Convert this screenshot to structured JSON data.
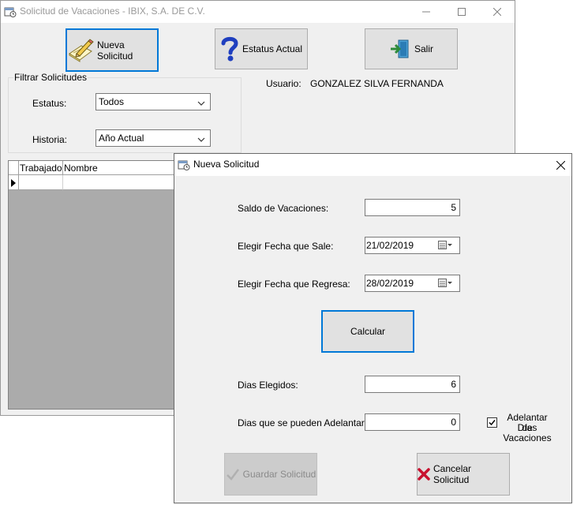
{
  "main_window": {
    "title": "Solicitud de Vacaciones - IBIX, S.A. DE C.V.",
    "toolbar": {
      "new_request_label": "Nueva Solicitud",
      "status_label": "Estatus Actual",
      "exit_label": "Salir"
    },
    "filter": {
      "group_title": "Filtrar Solicitudes",
      "status_label": "Estatus:",
      "status_value": "Todos",
      "history_label": "Historia:",
      "history_value": "Año Actual"
    },
    "user": {
      "label": "Usuario:",
      "name": "GONZALEZ SILVA FERNANDA"
    },
    "grid": {
      "columns": [
        "Trabajador",
        "Nombre"
      ]
    }
  },
  "dialog": {
    "title": "Nueva Solicitud",
    "balance_label": "Saldo de Vacaciones:",
    "balance_value": "5",
    "departure_label": "Elegir Fecha que Sale:",
    "departure_value": "21/02/2019",
    "return_label": "Elegir Fecha que Regresa:",
    "return_value": "28/02/2019",
    "calculate_label": "Calcular",
    "chosen_days_label": "Dias Elegidos:",
    "chosen_days_value": "6",
    "advance_days_label": "Dias que se pueden Adelantar:",
    "advance_days_value": "0",
    "advance_checkbox_line1": "Adelantar Días",
    "advance_checkbox_line2": "de Vacaciones",
    "advance_checkbox_checked": true,
    "save_label": "Guardar Solicitud",
    "cancel_label": "Cancelar Solicitud"
  },
  "colors": {
    "accent_focus": "#0078d7",
    "window_bg": "#f0f0f0",
    "cancel_x": "#c8102e"
  }
}
